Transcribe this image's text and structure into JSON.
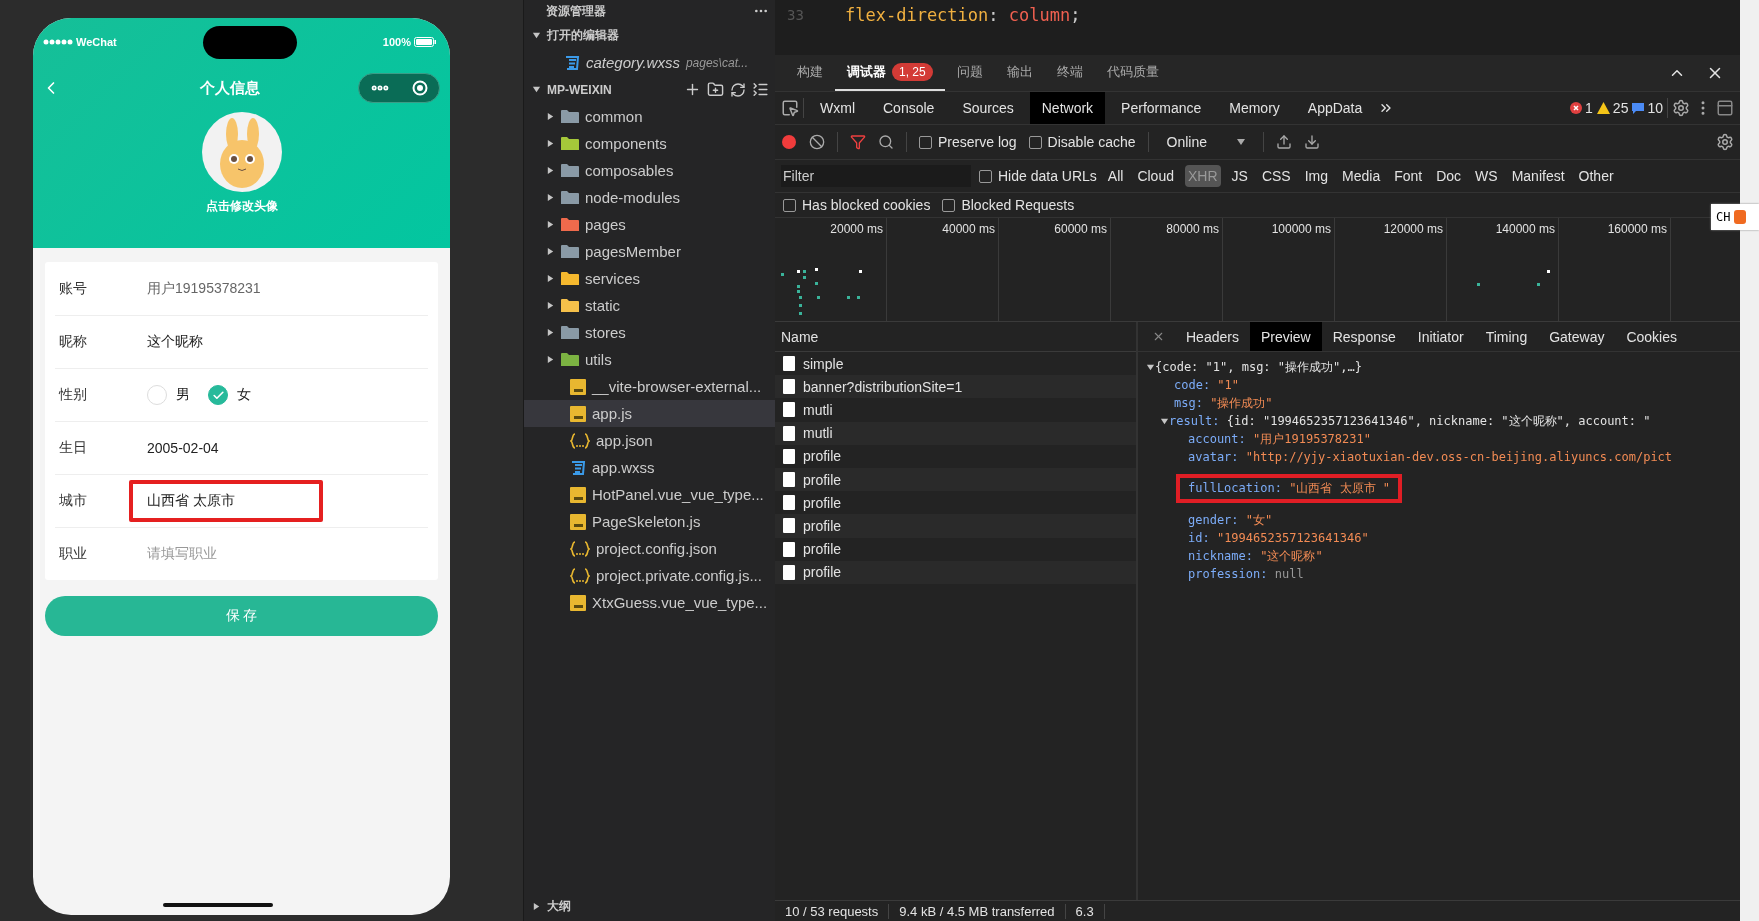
{
  "phone": {
    "status_bar": {
      "carrier": "WeChat",
      "battery": "100%"
    },
    "nav": {
      "title": "个人信息"
    },
    "avatar_caption": "点击修改头像",
    "form": [
      {
        "kind": "static",
        "label": "账号",
        "value": "用户19195378231",
        "highlighted": false
      },
      {
        "kind": "input",
        "label": "昵称",
        "value": "这个昵称",
        "highlighted": false
      },
      {
        "kind": "radio",
        "label": "性别",
        "options": [
          {
            "label": "男",
            "selected": false
          },
          {
            "label": "女",
            "selected": true
          }
        ],
        "highlighted": false
      },
      {
        "kind": "input",
        "label": "生日",
        "value": "2005-02-04",
        "highlighted": false
      },
      {
        "kind": "input",
        "label": "城市",
        "value": "山西省 太原市",
        "highlighted": true
      },
      {
        "kind": "placeholder",
        "label": "职业",
        "placeholder": "请填写职业",
        "highlighted": false
      }
    ],
    "save_button": "保 存"
  },
  "explorer": {
    "title": "资源管理器",
    "open_editors": {
      "title": "打开的编辑器",
      "expanded": true,
      "files": [
        {
          "name": "category.wxss",
          "path": "pages\\cat...",
          "kind": "wxss"
        }
      ]
    },
    "project": {
      "title": "MP-WEIXIN",
      "expanded": true,
      "items": [
        {
          "kind": "folder",
          "name": "common",
          "color": "#8a9aa6",
          "selected": false
        },
        {
          "kind": "folder",
          "name": "components",
          "color": "#a5c83a",
          "selected": false
        },
        {
          "kind": "folder",
          "name": "composables",
          "color": "#8a9aa6",
          "selected": false
        },
        {
          "kind": "folder",
          "name": "node-modules",
          "color": "#8a9aa6",
          "selected": false
        },
        {
          "kind": "folder",
          "name": "pages",
          "color": "#ef6a4c",
          "selected": false
        },
        {
          "kind": "folder",
          "name": "pagesMember",
          "color": "#8a9aa6",
          "selected": false
        },
        {
          "kind": "folder",
          "name": "services",
          "color": "#f5b82e",
          "selected": false
        },
        {
          "kind": "folder",
          "name": "static",
          "color": "#f5c04a",
          "selected": false
        },
        {
          "kind": "folder",
          "name": "stores",
          "color": "#8a9aa6",
          "selected": false
        },
        {
          "kind": "folder",
          "name": "utils",
          "color": "#7cb342",
          "selected": false
        },
        {
          "kind": "js",
          "name": "__vite-browser-external...",
          "selected": false
        },
        {
          "kind": "js",
          "name": "app.js",
          "selected": true
        },
        {
          "kind": "json",
          "name": "app.json",
          "selected": false
        },
        {
          "kind": "wxss",
          "name": "app.wxss",
          "selected": false
        },
        {
          "kind": "js",
          "name": "HotPanel.vue_vue_type...",
          "selected": false
        },
        {
          "kind": "js",
          "name": "PageSkeleton.js",
          "selected": false
        },
        {
          "kind": "json",
          "name": "project.config.json",
          "selected": false
        },
        {
          "kind": "json",
          "name": "project.private.config.js...",
          "selected": false
        },
        {
          "kind": "js",
          "name": "XtxGuess.vue_vue_type...",
          "selected": false
        }
      ]
    },
    "outline": {
      "title": "大纲",
      "expanded": false
    }
  },
  "editor": {
    "lines": [
      {
        "number": "33",
        "tokens": [
          {
            "text": "flex-direction",
            "kind": "property"
          },
          {
            "text": ": ",
            "kind": "punct"
          },
          {
            "text": "column",
            "kind": "value"
          },
          {
            "text": ";",
            "kind": "punct"
          }
        ]
      }
    ]
  },
  "devtools": {
    "top_tabs": [
      {
        "label": "构建",
        "selected": false
      },
      {
        "label": "调试器",
        "selected": true,
        "badge": "1, 25"
      },
      {
        "label": "问题",
        "selected": false
      },
      {
        "label": "输出",
        "selected": false
      },
      {
        "label": "终端",
        "selected": false
      },
      {
        "label": "代码质量",
        "selected": false
      }
    ],
    "panel_tabs": [
      {
        "label": "Wxml",
        "selected": false
      },
      {
        "label": "Console",
        "selected": false
      },
      {
        "label": "Sources",
        "selected": false
      },
      {
        "label": "Network",
        "selected": true
      },
      {
        "label": "Performance",
        "selected": false
      },
      {
        "label": "Memory",
        "selected": false
      },
      {
        "label": "AppData",
        "selected": false
      }
    ],
    "counts": {
      "errors": "1",
      "warnings": "25",
      "info": "10"
    },
    "toolbar": {
      "preserve_log": {
        "label": "Preserve log",
        "checked": false
      },
      "disable_cache": {
        "label": "Disable cache",
        "checked": false
      },
      "throttling": "Online"
    },
    "filter": {
      "placeholder": "Filter",
      "hide_data_urls": {
        "label": "Hide data URLs",
        "checked": false
      },
      "types": [
        {
          "label": "All",
          "selected": false
        },
        {
          "label": "Cloud",
          "selected": false
        },
        {
          "label": "XHR",
          "selected": true
        },
        {
          "label": "JS",
          "selected": false
        },
        {
          "label": "CSS",
          "selected": false
        },
        {
          "label": "Img",
          "selected": false
        },
        {
          "label": "Media",
          "selected": false
        },
        {
          "label": "Font",
          "selected": false
        },
        {
          "label": "Doc",
          "selected": false
        },
        {
          "label": "WS",
          "selected": false
        },
        {
          "label": "Manifest",
          "selected": false
        },
        {
          "label": "Other",
          "selected": false
        }
      ]
    },
    "blocked": [
      {
        "label": "Has blocked cookies",
        "checked": false
      },
      {
        "label": "Blocked Requests",
        "checked": false
      }
    ],
    "timeline_ticks": [
      "20000 ms",
      "40000 ms",
      "60000 ms",
      "80000 ms",
      "100000 ms",
      "120000 ms",
      "140000 ms",
      "160000 ms"
    ],
    "requests": {
      "header": "Name",
      "rows": [
        "simple",
        "banner?distributionSite=1",
        "mutli",
        "mutli",
        "profile",
        "profile",
        "profile",
        "profile",
        "profile",
        "profile"
      ]
    },
    "detail_tabs": [
      {
        "label": "Headers",
        "selected": false
      },
      {
        "label": "Preview",
        "selected": true
      },
      {
        "label": "Response",
        "selected": false
      },
      {
        "label": "Initiator",
        "selected": false
      },
      {
        "label": "Timing",
        "selected": false
      },
      {
        "label": "Gateway",
        "selected": false
      },
      {
        "label": "Cookies",
        "selected": false
      }
    ],
    "preview": {
      "summary": "{code: \"1\", msg: \"操作成功\",…}",
      "expanded": true,
      "children": [
        {
          "key": "code:",
          "value": "\"1\"",
          "kind": "string",
          "highlighted": false
        },
        {
          "key": "msg:",
          "value": "\"操作成功\"",
          "kind": "string",
          "highlighted": false
        },
        {
          "key": "result:",
          "summary": "{id: \"1994652357123641346\", nickname: \"这个昵称\", account: \"",
          "expanded": true,
          "children": [
            {
              "key": "account:",
              "value": "\"用户19195378231\"",
              "kind": "string",
              "highlighted": false
            },
            {
              "key": "avatar:",
              "value": "\"http://yjy-xiaotuxian-dev.oss-cn-beijing.aliyuncs.com/pict",
              "kind": "string",
              "highlighted": false
            },
            {
              "key": "fullLocation:",
              "value": "\"山西省 太原市 \"",
              "kind": "string",
              "highlighted": true
            },
            {
              "key": "gender:",
              "value": "\"女\"",
              "kind": "string",
              "highlighted": false
            },
            {
              "key": "id:",
              "value": "\"1994652357123641346\"",
              "kind": "string",
              "highlighted": false
            },
            {
              "key": "nickname:",
              "value": "\"这个昵称\"",
              "kind": "string",
              "highlighted": false
            },
            {
              "key": "profession:",
              "value": "null",
              "kind": "null",
              "highlighted": false
            }
          ]
        }
      ]
    },
    "status_bar": [
      "10 / 53 requests",
      "9.4 kB / 4.5 MB transferred",
      "6.3"
    ]
  },
  "ime_indicator": "CH"
}
